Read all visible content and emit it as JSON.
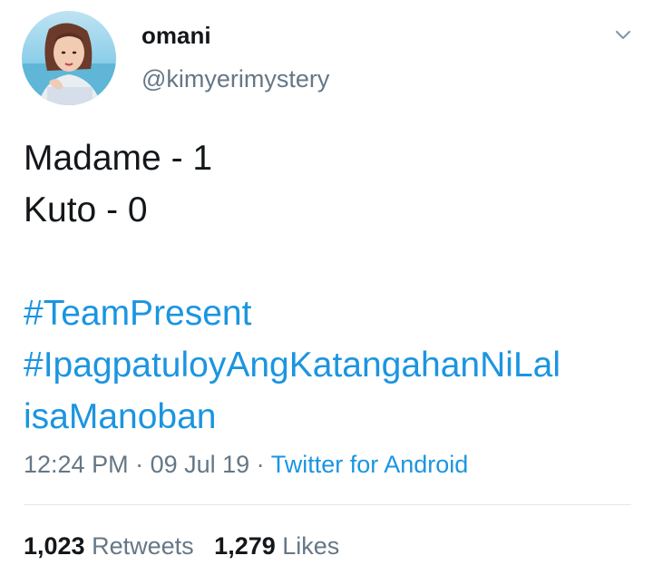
{
  "author": {
    "display_name": "omani",
    "handle": "@kimyerimystery"
  },
  "icons": {
    "avatar": "profile-photo",
    "menu": "chevron-down-icon"
  },
  "tweet": {
    "lines": [
      "Madame - 1",
      "Kuto - 0"
    ],
    "hashtags": [
      "#TeamPresent",
      "#IpagpatuloyAngKatangahanNiLal",
      "isaManoban"
    ]
  },
  "meta": {
    "time": "12:24 PM",
    "sep1": " · ",
    "date": "09 Jul 19",
    "sep2": " · ",
    "source": "Twitter for Android"
  },
  "stats": {
    "retweets_count": "1,023",
    "retweets_label": "Retweets",
    "likes_count": "1,279",
    "likes_label": "Likes"
  },
  "colors": {
    "link": "#1b95e0",
    "secondary_text": "#657786",
    "primary_text": "#14171a",
    "divider": "#e1e8ed"
  }
}
